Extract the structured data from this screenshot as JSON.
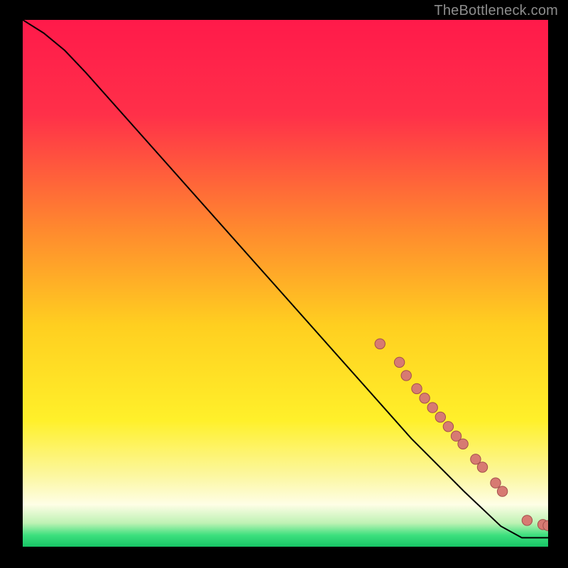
{
  "attribution": "TheBottleneck.com",
  "colors": {
    "page_bg": "#000000",
    "gradient_top": "#ff1a4a",
    "gradient_mid_upper": "#ff6e39",
    "gradient_mid": "#ffd015",
    "gradient_mid_lower": "#fff12a",
    "gradient_pale": "#fdfcdc",
    "gradient_green": "#2fe07a",
    "curve_stroke": "#000000",
    "marker_fill": "#d77a72",
    "marker_stroke": "#a24e4c"
  },
  "chart_data": {
    "type": "line",
    "title": "",
    "xlabel": "",
    "ylabel": "",
    "xlim": [
      0,
      100
    ],
    "ylim": [
      0,
      100
    ],
    "curve": [
      {
        "x": 0,
        "y": 100
      },
      {
        "x": 4,
        "y": 97.5
      },
      {
        "x": 8,
        "y": 94.2
      },
      {
        "x": 12,
        "y": 90
      },
      {
        "x": 74,
        "y": 20.5
      },
      {
        "x": 84,
        "y": 10.5
      },
      {
        "x": 91,
        "y": 3.9
      },
      {
        "x": 95,
        "y": 1.7
      },
      {
        "x": 100,
        "y": 1.7
      }
    ],
    "markers": [
      {
        "x": 68,
        "y": 38.5
      },
      {
        "x": 71.7,
        "y": 35.0
      },
      {
        "x": 73,
        "y": 32.5
      },
      {
        "x": 75,
        "y": 30.0
      },
      {
        "x": 76.5,
        "y": 28.2
      },
      {
        "x": 78,
        "y": 26.4
      },
      {
        "x": 79.5,
        "y": 24.6
      },
      {
        "x": 81,
        "y": 22.8
      },
      {
        "x": 82.5,
        "y": 21.0
      },
      {
        "x": 83.8,
        "y": 19.5
      },
      {
        "x": 86.2,
        "y": 16.6
      },
      {
        "x": 87.5,
        "y": 15.1
      },
      {
        "x": 90,
        "y": 12.1
      },
      {
        "x": 91.3,
        "y": 10.5
      },
      {
        "x": 96,
        "y": 5
      },
      {
        "x": 99,
        "y": 4.2
      },
      {
        "x": 100,
        "y": 4
      }
    ],
    "gradient_bands": [
      {
        "stop": 0.0,
        "color": "#ff1a4a"
      },
      {
        "stop": 0.18,
        "color": "#ff3049"
      },
      {
        "stop": 0.4,
        "color": "#ff8a2e"
      },
      {
        "stop": 0.58,
        "color": "#ffcf20"
      },
      {
        "stop": 0.76,
        "color": "#fff02a"
      },
      {
        "stop": 0.865,
        "color": "#fcf7a0"
      },
      {
        "stop": 0.92,
        "color": "#fefee6"
      },
      {
        "stop": 0.955,
        "color": "#bff2b4"
      },
      {
        "stop": 0.978,
        "color": "#3de07e"
      },
      {
        "stop": 1.0,
        "color": "#17c566"
      }
    ]
  }
}
